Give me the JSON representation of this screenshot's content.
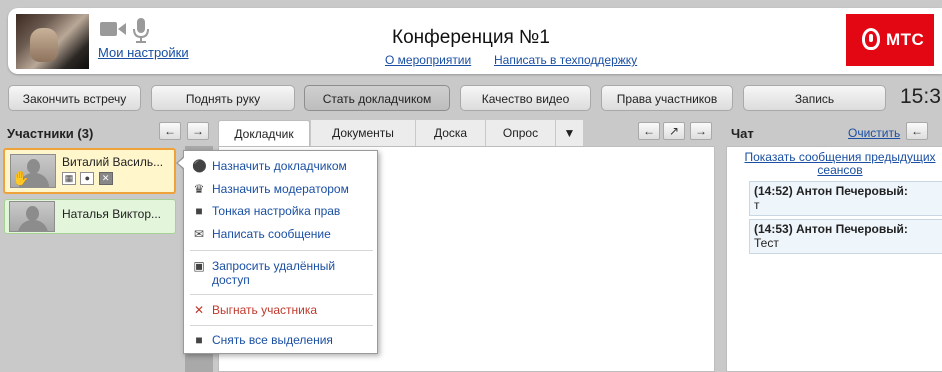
{
  "header": {
    "settings_link": "Мои настройки",
    "conference_title": "Конференция №1",
    "about_link": "О мероприятии",
    "support_link": "Написать в техподдержку",
    "logo_text": "МТС"
  },
  "toolbar": {
    "end_meeting": "Закончить встречу",
    "raise_hand": "Поднять руку",
    "become_speaker": "Стать докладчиком",
    "video_quality": "Качество видео",
    "participant_rights": "Права участников",
    "record": "Запись",
    "clock": "15:3"
  },
  "participants": {
    "title": "Участники (3)",
    "items": [
      {
        "name": "Виталий Васильев",
        "display": "Виталий Василь..."
      },
      {
        "name": "Наталья Викторовна",
        "display": "Наталья Виктор..."
      }
    ]
  },
  "tabs": [
    {
      "label": "Докладчик"
    },
    {
      "label": "Документы"
    },
    {
      "label": "Доска"
    },
    {
      "label": "Опрос"
    }
  ],
  "context_menu": {
    "items": [
      {
        "label": "Назначить докладчиком",
        "icon": "speech-bubble-icon"
      },
      {
        "label": "Назначить модератором",
        "icon": "crown-icon"
      },
      {
        "label": "Тонкая настройка прав",
        "icon": "user-icon"
      },
      {
        "label": "Написать сообщение",
        "icon": "envelope-icon"
      },
      {
        "label": "Запросить удалённый доступ",
        "label_line1": "Запросить удалённый",
        "label_line2": "доступ",
        "icon": "remote-screen-icon"
      },
      {
        "label": "Выгнать участника",
        "icon": "close-icon"
      },
      {
        "label": "Снять все выделения",
        "icon": "user-icon"
      }
    ]
  },
  "chat": {
    "title": "Чат",
    "clear_link": "Очистить",
    "show_previous": "Показать сообщения предыдущих сеансов",
    "show_previous_line1": "Показать сообщения предыдущих",
    "show_previous_line2": "сеансов",
    "messages": [
      {
        "time": "(14:52)",
        "author": "Антон Печеровый:",
        "header": "(14:52) Антон Печеровый:",
        "text": "т"
      },
      {
        "time": "(14:53)",
        "author": "Антон Печеровый:",
        "header": "(14:53) Антон Печеровый:",
        "text": "Тест"
      }
    ]
  },
  "colors": {
    "brand_red": "#e30613",
    "link_blue": "#1a4fa3",
    "selected_border": "#f0a23a",
    "kick_red": "#c0392b"
  }
}
